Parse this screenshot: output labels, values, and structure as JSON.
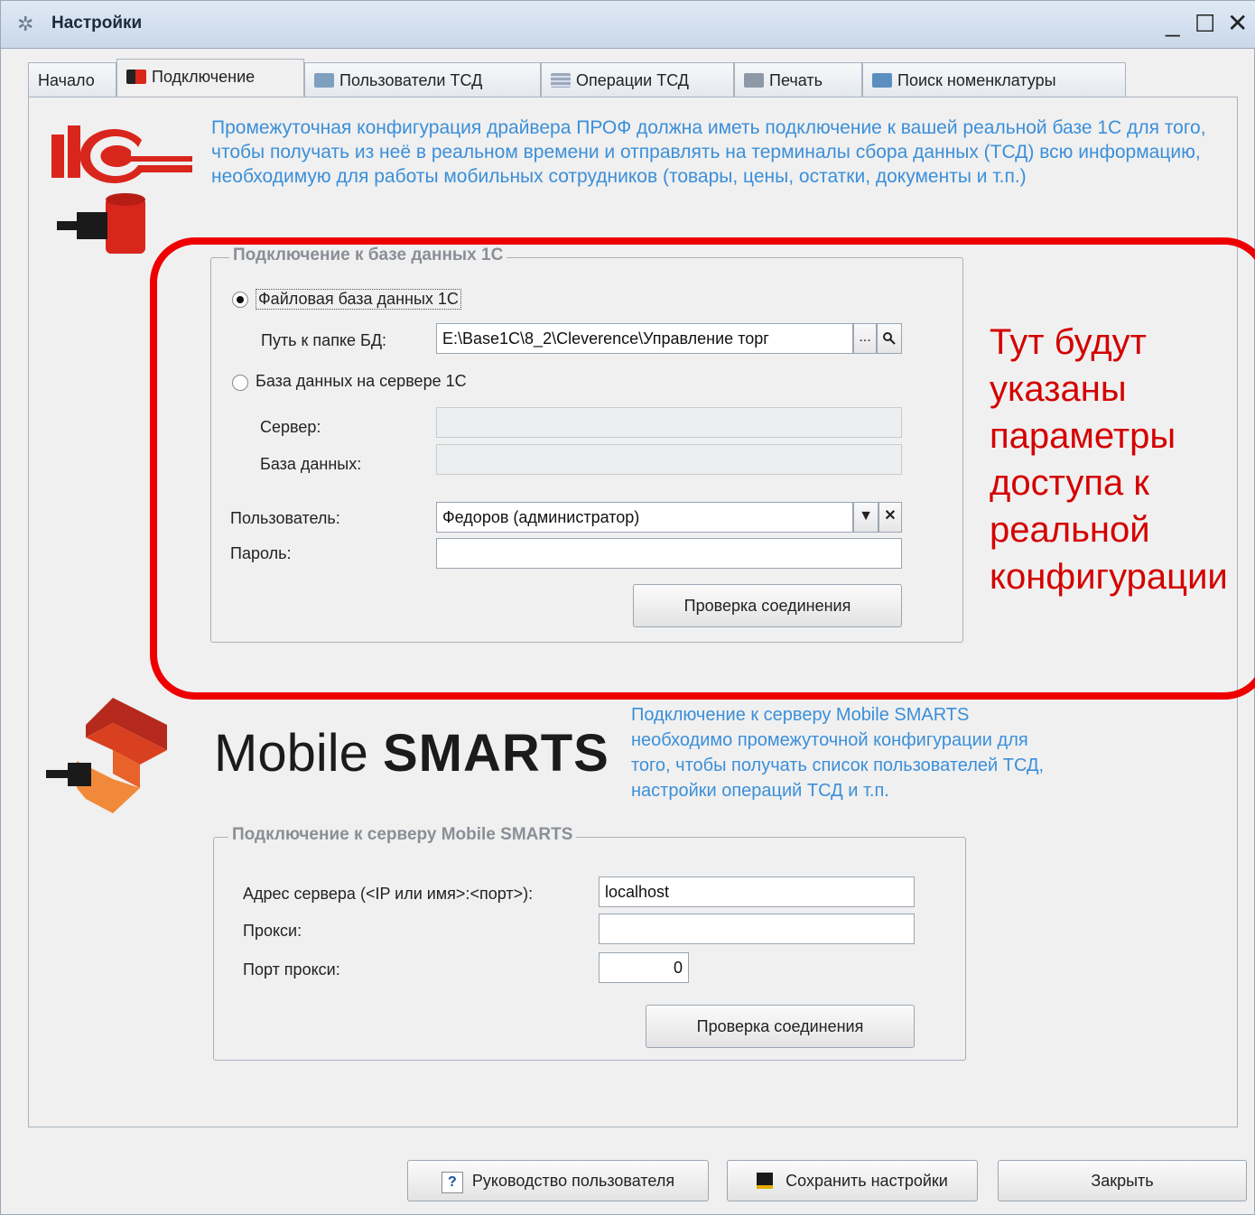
{
  "window": {
    "title": "Настройки",
    "minimize": "_",
    "maximize": "☐",
    "close": "✕"
  },
  "tabs": [
    {
      "label": "Начало",
      "icon": "none"
    },
    {
      "label": "Подключение",
      "icon": "plug-icon"
    },
    {
      "label": "Пользователи ТСД",
      "icon": "users-icon"
    },
    {
      "label": "Операции ТСД",
      "icon": "operations-icon"
    },
    {
      "label": "Печать",
      "icon": "printer-icon"
    },
    {
      "label": "Поиск номенклатуры",
      "icon": "search-doc-icon"
    }
  ],
  "db_section": {
    "info_text": "Промежуточная конфигурация драйвера ПРОФ должна иметь подключение к вашей реальной базе 1С для того, чтобы получать из неё в реальном времени и отправлять на терминалы сбора данных (ТСД) всю информацию, необходимую для работы мобильных сотрудников (товары, цены, остатки, документы и т.п.)",
    "group_title": "Подключение к базе данных 1С",
    "radio_file": "Файловая база данных 1С",
    "path_label": "Путь к папке БД:",
    "path_value": "E:\\Base1C\\8_2\\Cleverence\\Управление торг",
    "browse_label": "...",
    "radio_server": "База данных на сервере 1С",
    "server_label": "Сервер:",
    "server_value": "",
    "database_label": "База данных:",
    "database_value": "",
    "user_label": "Пользователь:",
    "user_value": "Федоров (администратор)",
    "password_label": "Пароль:",
    "password_value": "",
    "test_button": "Проверка соединения"
  },
  "annotation": {
    "lines": [
      "Тут будут",
      "указаны",
      "параметры",
      "доступа к",
      "реальной",
      "конфигурации"
    ],
    "color": "#d40000"
  },
  "ms_section": {
    "logo_text_regular": "Mobile ",
    "logo_text_bold": "SMARTS",
    "info_text_lines": [
      "Подключение к серверу Mobile SMARTS",
      "необходимо промежуточной конфигурации для",
      "того, чтобы получать список пользователей ТСД,",
      "настройки операций ТСД и т.п."
    ],
    "group_title": "Подключение к серверу Mobile SMARTS",
    "address_label": "Адрес сервера (<IP или имя>:<порт>):",
    "address_value": "localhost",
    "proxy_label": "Прокси:",
    "proxy_value": "",
    "proxy_port_label": "Порт прокси:",
    "proxy_port_value": "0",
    "test_button": "Проверка соединения"
  },
  "footer": {
    "manual_button": "Руководство пользователя",
    "manual_icon": "?",
    "save_button": "Сохранить настройки",
    "close_button": "Закрыть"
  },
  "colors": {
    "info_blue": "#3b8fd9",
    "brand_red": "#d9261c",
    "ms_orange": "#e8622a"
  }
}
